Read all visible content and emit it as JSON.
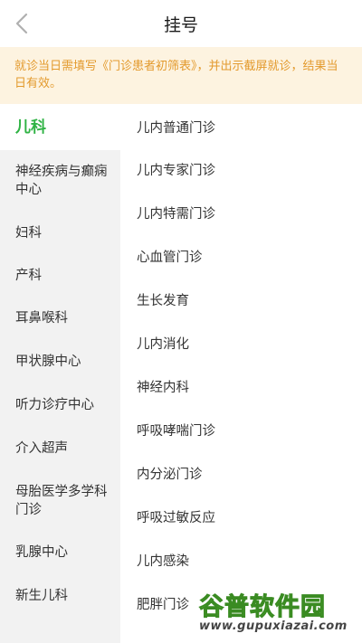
{
  "navbar": {
    "title": "挂号"
  },
  "notice": {
    "text": "就诊当日需填写《门诊患者初筛表》，并出示截屏就诊，结果当日有效。"
  },
  "sidebar": {
    "items": [
      {
        "label": "儿科"
      },
      {
        "label": "神经疾病与癫痫中心"
      },
      {
        "label": "妇科"
      },
      {
        "label": "产科"
      },
      {
        "label": "耳鼻喉科"
      },
      {
        "label": "甲状腺中心"
      },
      {
        "label": "听力诊疗中心"
      },
      {
        "label": "介入超声"
      },
      {
        "label": "母胎医学多学科门诊"
      },
      {
        "label": "乳腺中心"
      },
      {
        "label": "新生儿科"
      }
    ],
    "selected": "儿科"
  },
  "clinics": {
    "items": [
      {
        "label": "儿内普通门诊"
      },
      {
        "label": "儿内专家门诊"
      },
      {
        "label": "儿内特需门诊"
      },
      {
        "label": "心血管门诊"
      },
      {
        "label": "生长发育"
      },
      {
        "label": "儿内消化"
      },
      {
        "label": "神经内科"
      },
      {
        "label": "呼吸哮喘门诊"
      },
      {
        "label": "内分泌门诊"
      },
      {
        "label": "呼吸过敏反应"
      },
      {
        "label": "儿内感染"
      },
      {
        "label": "肥胖门诊"
      }
    ]
  },
  "watermark": {
    "title": "谷普软件园",
    "url": "www.gupuxiazai.com"
  },
  "colors": {
    "accent": "#2fb344",
    "notice_bg": "#fdf3e0",
    "notice_text": "#e39a2d",
    "sidebar_bg": "#f2f2f2"
  }
}
